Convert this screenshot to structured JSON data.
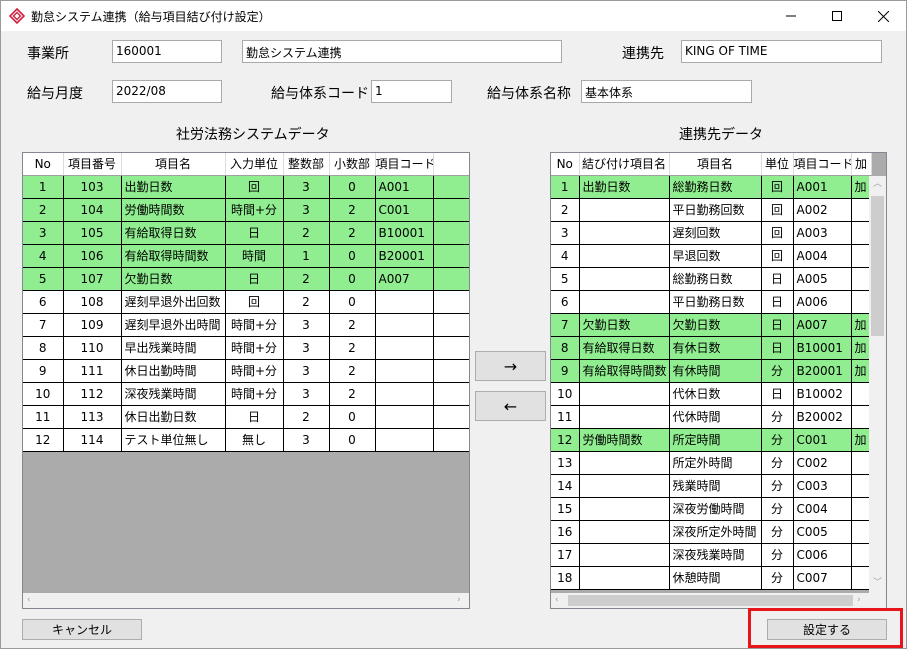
{
  "window": {
    "title": "勤怠システム連携（給与項目結び付け設定）",
    "brand_color": "#d21f3c"
  },
  "header": {
    "office_label": "事業所",
    "office_code": "160001",
    "office_name": "勤怠システム連携",
    "partner_label": "連携先",
    "partner_value": "KING OF TIME",
    "month_label": "給与月度",
    "month_value": "2022/08",
    "system_code_label": "給与体系コード",
    "system_code_value": "1",
    "system_name_label": "給与体系名称",
    "system_name_value": "基本体系"
  },
  "left_panel": {
    "title": "社労法務システムデータ",
    "columns": [
      "No",
      "項目番号",
      "項目名",
      "入力単位",
      "整数部",
      "小数部",
      "項目コード"
    ],
    "rows": [
      {
        "no": "1",
        "item_no": "103",
        "name": "出勤日数",
        "unit": "回",
        "int": "3",
        "dec": "0",
        "code": "A001",
        "highlight": true
      },
      {
        "no": "2",
        "item_no": "104",
        "name": "労働時間数",
        "unit": "時間+分",
        "int": "3",
        "dec": "2",
        "code": "C001",
        "highlight": true
      },
      {
        "no": "3",
        "item_no": "105",
        "name": "有給取得日数",
        "unit": "日",
        "int": "2",
        "dec": "2",
        "code": "B10001",
        "highlight": true
      },
      {
        "no": "4",
        "item_no": "106",
        "name": "有給取得時間数",
        "unit": "時間",
        "int": "1",
        "dec": "0",
        "code": "B20001",
        "highlight": true
      },
      {
        "no": "5",
        "item_no": "107",
        "name": "欠勤日数",
        "unit": "日",
        "int": "2",
        "dec": "0",
        "code": "A007",
        "highlight": true
      },
      {
        "no": "6",
        "item_no": "108",
        "name": "遅刻早退外出回数",
        "unit": "回",
        "int": "2",
        "dec": "0",
        "code": "",
        "highlight": false
      },
      {
        "no": "7",
        "item_no": "109",
        "name": "遅刻早退外出時間",
        "unit": "時間+分",
        "int": "3",
        "dec": "2",
        "code": "",
        "highlight": false
      },
      {
        "no": "8",
        "item_no": "110",
        "name": "早出残業時間",
        "unit": "時間+分",
        "int": "3",
        "dec": "2",
        "code": "",
        "highlight": false
      },
      {
        "no": "9",
        "item_no": "111",
        "name": "休日出勤時間",
        "unit": "時間+分",
        "int": "3",
        "dec": "2",
        "code": "",
        "highlight": false
      },
      {
        "no": "10",
        "item_no": "112",
        "name": "深夜残業時間",
        "unit": "時間+分",
        "int": "3",
        "dec": "2",
        "code": "",
        "highlight": false
      },
      {
        "no": "11",
        "item_no": "113",
        "name": "休日出勤日数",
        "unit": "日",
        "int": "2",
        "dec": "0",
        "code": "",
        "highlight": false
      },
      {
        "no": "12",
        "item_no": "114",
        "name": "テスト単位無し",
        "unit": "無し",
        "int": "3",
        "dec": "0",
        "code": "",
        "highlight": false
      }
    ]
  },
  "right_panel": {
    "title": "連携先データ",
    "columns": [
      "No",
      "結び付け項目名",
      "項目名",
      "単位",
      "項目コード",
      "加"
    ],
    "rows": [
      {
        "no": "1",
        "link": "出勤日数",
        "name": "総勤務日数",
        "unit": "回",
        "code": "A001",
        "extra": "加",
        "highlight": true
      },
      {
        "no": "2",
        "link": "",
        "name": "平日勤務回数",
        "unit": "回",
        "code": "A002",
        "extra": "",
        "highlight": false
      },
      {
        "no": "3",
        "link": "",
        "name": "遅刻回数",
        "unit": "回",
        "code": "A003",
        "extra": "",
        "highlight": false
      },
      {
        "no": "4",
        "link": "",
        "name": "早退回数",
        "unit": "回",
        "code": "A004",
        "extra": "",
        "highlight": false
      },
      {
        "no": "5",
        "link": "",
        "name": "総勤務日数",
        "unit": "日",
        "code": "A005",
        "extra": "",
        "highlight": false
      },
      {
        "no": "6",
        "link": "",
        "name": "平日勤務日数",
        "unit": "日",
        "code": "A006",
        "extra": "",
        "highlight": false
      },
      {
        "no": "7",
        "link": "欠勤日数",
        "name": "欠勤日数",
        "unit": "日",
        "code": "A007",
        "extra": "加",
        "highlight": true
      },
      {
        "no": "8",
        "link": "有給取得日数",
        "name": "有休日数",
        "unit": "日",
        "code": "B10001",
        "extra": "加",
        "highlight": true
      },
      {
        "no": "9",
        "link": "有給取得時間数",
        "name": "有休時間",
        "unit": "分",
        "code": "B20001",
        "extra": "加",
        "highlight": true
      },
      {
        "no": "10",
        "link": "",
        "name": "代休日数",
        "unit": "日",
        "code": "B10002",
        "extra": "",
        "highlight": false
      },
      {
        "no": "11",
        "link": "",
        "name": "代休時間",
        "unit": "分",
        "code": "B20002",
        "extra": "",
        "highlight": false
      },
      {
        "no": "12",
        "link": "労働時間数",
        "name": "所定時間",
        "unit": "分",
        "code": "C001",
        "extra": "加",
        "highlight": true
      },
      {
        "no": "13",
        "link": "",
        "name": "所定外時間",
        "unit": "分",
        "code": "C002",
        "extra": "",
        "highlight": false
      },
      {
        "no": "14",
        "link": "",
        "name": "残業時間",
        "unit": "分",
        "code": "C003",
        "extra": "",
        "highlight": false
      },
      {
        "no": "15",
        "link": "",
        "name": "深夜労働時間",
        "unit": "分",
        "code": "C004",
        "extra": "",
        "highlight": false
      },
      {
        "no": "16",
        "link": "",
        "name": "深夜所定外時間",
        "unit": "分",
        "code": "C005",
        "extra": "",
        "highlight": false
      },
      {
        "no": "17",
        "link": "",
        "name": "深夜残業時間",
        "unit": "分",
        "code": "C006",
        "extra": "",
        "highlight": false
      },
      {
        "no": "18",
        "link": "",
        "name": "休憩時間",
        "unit": "分",
        "code": "C007",
        "extra": "",
        "highlight": false
      }
    ]
  },
  "buttons": {
    "link_right": "→",
    "link_left": "←",
    "cancel": "キャンセル",
    "save": "設定する"
  },
  "colors": {
    "highlight_row": "#90ee90",
    "callout_border": "#e8141c"
  }
}
